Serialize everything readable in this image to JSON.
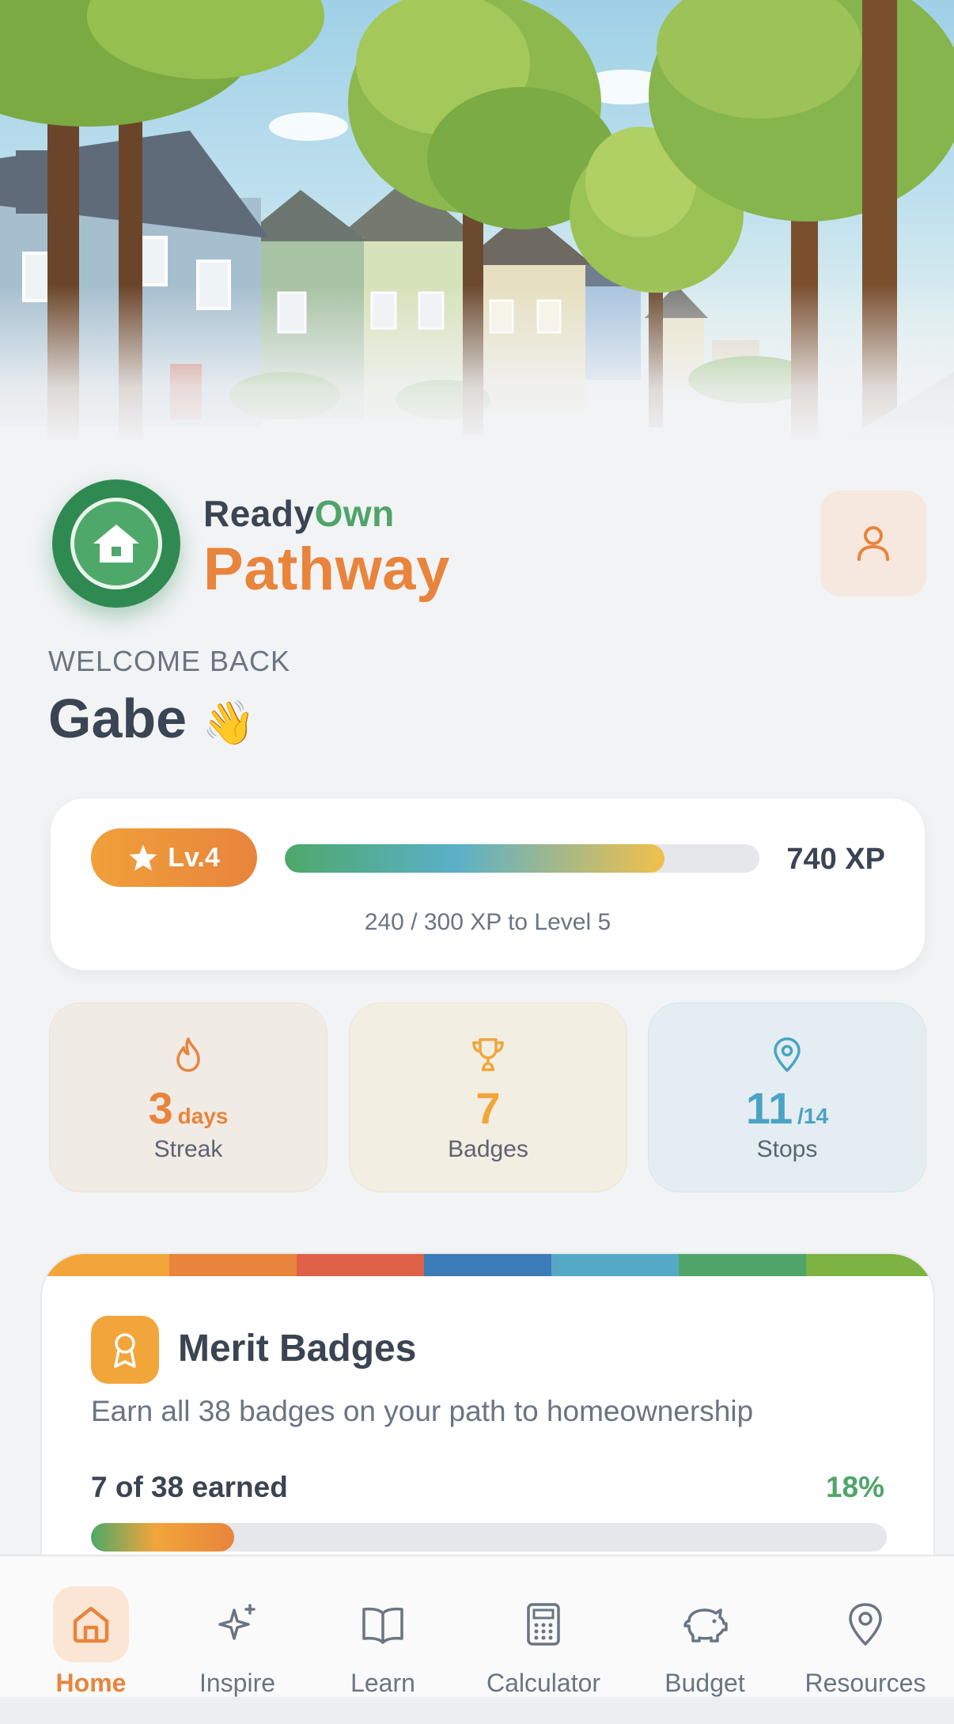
{
  "brand": {
    "name_part1": "Ready",
    "name_part2": "Own",
    "subtitle": "Pathway"
  },
  "welcome": {
    "label": "WELCOME BACK",
    "name": "Gabe",
    "emoji": "👋"
  },
  "level": {
    "label": "Lv.4",
    "xp_total": "740 XP",
    "progress_caption": "240 / 300 XP to Level 5",
    "progress_fraction": 0.8
  },
  "stats": [
    {
      "value": "3",
      "unit": "days",
      "label": "Streak",
      "icon": "flame-icon",
      "color": "#e8843c"
    },
    {
      "value": "7",
      "unit": "",
      "label": "Badges",
      "icon": "trophy-icon",
      "color": "#f2a53a"
    },
    {
      "value": "11",
      "unit": "/14",
      "label": "Stops",
      "icon": "map-pin-icon",
      "color": "#4aa3c4"
    }
  ],
  "merit": {
    "title": "Merit Badges",
    "subtitle": "Earn all 38 badges on your path to homeownership",
    "count_text": "7 of 38 earned",
    "percent_text": "18%",
    "progress_fraction": 0.18,
    "stripe_colors": [
      "#f2a53a",
      "#e8843c",
      "#df6148",
      "#3a7bb8",
      "#55a9c6",
      "#4fa46a",
      "#7cb342"
    ]
  },
  "nav": [
    {
      "label": "Home",
      "icon": "home-icon",
      "active": true
    },
    {
      "label": "Inspire",
      "icon": "sparkles-icon",
      "active": false
    },
    {
      "label": "Learn",
      "icon": "book-icon",
      "active": false
    },
    {
      "label": "Calculator",
      "icon": "calculator-icon",
      "active": false
    },
    {
      "label": "Budget",
      "icon": "piggy-bank-icon",
      "active": false
    },
    {
      "label": "Resources",
      "icon": "map-pin-icon",
      "active": false
    }
  ],
  "colors": {
    "accent_orange": "#e8843c",
    "brand_green": "#4fa46a",
    "text_dark": "#3a4452",
    "text_muted": "#6b7482"
  }
}
